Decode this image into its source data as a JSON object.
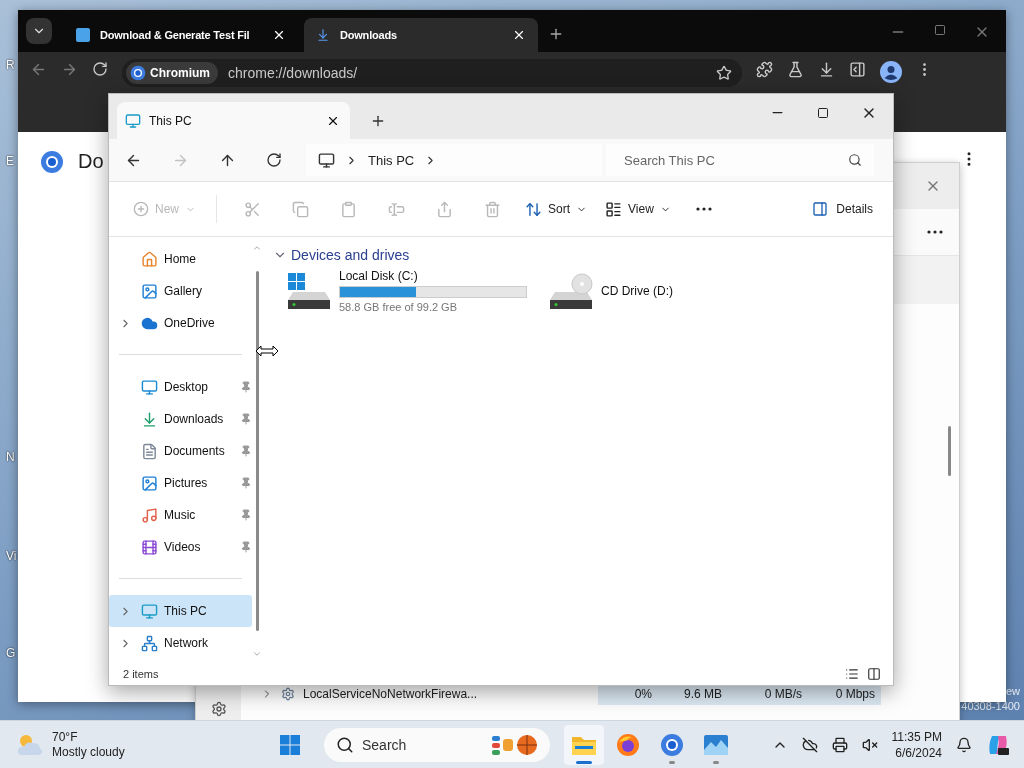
{
  "desktop": {
    "icon_labels": [
      "R",
      "E",
      "N",
      "Vi",
      "G"
    ],
    "build_text": [
      "ew",
      "40308-1400"
    ]
  },
  "browser": {
    "tabs": [
      {
        "title": "Download & Generate Test Fil",
        "selected": false
      },
      {
        "title": "Downloads",
        "selected": true
      }
    ],
    "site_chip": "Chromium",
    "url": "chrome://downloads/",
    "page_title": "Do"
  },
  "task_manager": {
    "rows": [
      {
        "name": "LocalServiceNoNetworkFirewa...",
        "cpu": "0%",
        "memory": "9.6 MB",
        "disk": "0 MB/s",
        "network": "0 Mbps"
      }
    ]
  },
  "explorer": {
    "tab": "This PC",
    "breadcrumb": "This PC",
    "search": {
      "placeholder": "Search This PC"
    },
    "nav": [
      {
        "kind": "back",
        "disabled": false
      },
      {
        "kind": "forward",
        "disabled": true
      },
      {
        "kind": "up",
        "disabled": false
      },
      {
        "kind": "refresh",
        "disabled": false
      }
    ],
    "commands": [
      {
        "kind": "new",
        "label": "New",
        "disabled": true
      },
      {
        "kind": "cut",
        "disabled": true
      },
      {
        "kind": "copy",
        "disabled": true
      },
      {
        "kind": "paste",
        "disabled": true
      },
      {
        "kind": "rename",
        "disabled": true
      },
      {
        "kind": "share",
        "disabled": true
      },
      {
        "kind": "delete",
        "disabled": true
      },
      {
        "kind": "sort",
        "label": "Sort",
        "disabled": false
      },
      {
        "kind": "view",
        "label": "View",
        "disabled": false
      },
      {
        "kind": "more",
        "disabled": false
      }
    ],
    "details": "Details",
    "sidebar": {
      "sections": [
        {
          "items": [
            {
              "kind": "home",
              "label": "Home",
              "expandable": false,
              "pinned": false,
              "selected": false
            },
            {
              "kind": "gallery",
              "label": "Gallery",
              "expandable": false,
              "pinned": false,
              "selected": false
            },
            {
              "kind": "onedrive",
              "label": "OneDrive",
              "expandable": true,
              "pinned": false,
              "selected": false
            }
          ]
        },
        {
          "items": [
            {
              "kind": "desktop",
              "label": "Desktop",
              "expandable": false,
              "pinned": true,
              "selected": false
            },
            {
              "kind": "downloads",
              "label": "Downloads",
              "expandable": false,
              "pinned": true,
              "selected": false
            },
            {
              "kind": "documents",
              "label": "Documents",
              "expandable": false,
              "pinned": true,
              "selected": false
            },
            {
              "kind": "pictures",
              "label": "Pictures",
              "expandable": false,
              "pinned": true,
              "selected": false
            },
            {
              "kind": "music",
              "label": "Music",
              "expandable": false,
              "pinned": true,
              "selected": false
            },
            {
              "kind": "videos",
              "label": "Videos",
              "expandable": false,
              "pinned": true,
              "selected": false
            }
          ]
        },
        {
          "items": [
            {
              "kind": "thispc",
              "label": "This PC",
              "expandable": true,
              "pinned": false,
              "selected": true
            },
            {
              "kind": "network",
              "label": "Network",
              "expandable": true,
              "pinned": false,
              "selected": false
            }
          ]
        }
      ]
    },
    "group": {
      "title": "Devices and drives",
      "expanded": true
    },
    "drives": [
      {
        "kind": "disk",
        "name": "Local Disk (C:)",
        "level": 0.41,
        "free_text": "58.8 GB free of 99.2 GB"
      },
      {
        "kind": "cd",
        "name": "CD Drive (D:)"
      }
    ],
    "status": "2 items"
  },
  "taskbar": {
    "weather": {
      "temp": "70°F",
      "condition": "Mostly cloudy"
    },
    "search": {
      "placeholder": "Search"
    },
    "apps": [
      {
        "kind": "explorer",
        "open": true,
        "selected": true
      },
      {
        "kind": "firefox",
        "open": false,
        "selected": false
      },
      {
        "kind": "chromium",
        "open": true,
        "selected": false
      },
      {
        "kind": "photos",
        "open": true,
        "selected": false
      }
    ],
    "time": "11:35 PM",
    "date": "6/6/2024"
  }
}
